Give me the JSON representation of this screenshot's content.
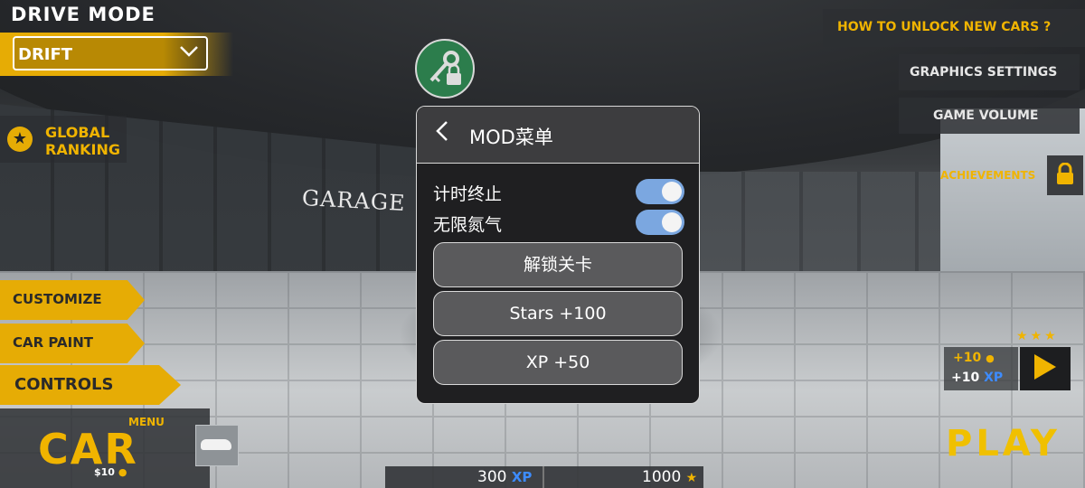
{
  "scene": {
    "garage_sign": "GARAGE"
  },
  "drive_mode": {
    "label": "DRIVE MODE",
    "selected": "DRIFT"
  },
  "global_ranking": {
    "line1": "GLOBAL",
    "line2": "RANKING"
  },
  "side_menu": {
    "customize": "CUSTOMIZE",
    "car_paint": "CAR PAINT",
    "controls": "CONTROLS"
  },
  "car_menu": {
    "small_label": "MENU",
    "big_label": "CAR",
    "price": "$10"
  },
  "top_right": {
    "how_to_unlock": "HOW TO UNLOCK NEW CARS ?",
    "graphics_settings": "GRAPHICS SETTINGS",
    "game_volume": "GAME VOLUME",
    "achievements": "ACHIEVEMENTS"
  },
  "reward": {
    "stars": "★★★",
    "coins": "+10",
    "xp_value": "+10",
    "xp_unit": "XP"
  },
  "play": {
    "label": "PLAY"
  },
  "bottom_bar": {
    "xp_value": "300",
    "xp_unit": "XP",
    "coins_value": "1000"
  },
  "mod_menu": {
    "title": "MOD菜单",
    "toggles": [
      {
        "label": "计时终止",
        "on": true
      },
      {
        "label": "无限氮气",
        "on": true
      }
    ],
    "buttons": [
      "解锁关卡",
      "Stars +100",
      "XP +50"
    ]
  },
  "colors": {
    "accent": "#e6ac05",
    "toggle_on": "#7ba7e0",
    "fab": "#2c7d4c",
    "xp_blue": "#3d8cff"
  }
}
